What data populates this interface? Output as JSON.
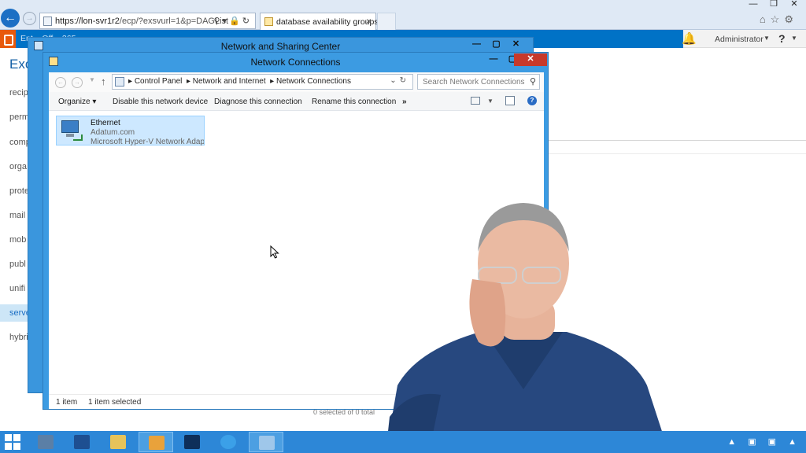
{
  "browser": {
    "url_main": "https://lon-svr1r2",
    "url_rest": "/ecp/?exsvurl=1&p=DAGList",
    "tab_label": "database availability groups...",
    "window_controls": {
      "minimize": "—",
      "maximize": "❐",
      "close": "✕"
    }
  },
  "ecp": {
    "nav_partial": "Ent...           Off... 365",
    "title_partial": "Exc",
    "user": "Administrator",
    "help_label": "?",
    "left_nav": [
      "recip",
      "perm",
      "comp",
      "orga",
      "prote",
      "mail",
      "mob",
      "publ",
      "unifi",
      "serve",
      "hybri"
    ],
    "active_nav": "serve",
    "footer_text": "0 selected of 0 total"
  },
  "nsc_window": {
    "title": "Network and Sharing Center",
    "controls": {
      "minimize": "—",
      "maximize": "▢",
      "close": "✕"
    }
  },
  "nc_window": {
    "title": "Network Connections",
    "controls": {
      "minimize": "—",
      "maximize": "▢",
      "close": "✕"
    },
    "breadcrumb": [
      "Control Panel",
      "Network and Internet",
      "Network Connections"
    ],
    "search_placeholder": "Search Network Connections",
    "commands": {
      "organize": "Organize",
      "disable": "Disable this network device",
      "diagnose": "Diagnose this connection",
      "rename": "Rename this connection",
      "more": "»"
    },
    "adapter": {
      "name": "Ethernet",
      "domain": "Adatum.com",
      "device": "Microsoft Hyper-V Network Adap..."
    },
    "status": {
      "items": "1 item",
      "selected": "1 item selected"
    }
  },
  "taskbar": {
    "apps": [
      "server-manager",
      "powershell",
      "file-explorer",
      "control-panel",
      "remote-desktop",
      "internet-explorer",
      "network-connections"
    ],
    "active_app": "network-connections"
  },
  "colors": {
    "window_frame": "#3c9be2",
    "ecp_header": "#0072c6",
    "taskbar": "#2d87d7",
    "selection": "#cde8ff"
  }
}
